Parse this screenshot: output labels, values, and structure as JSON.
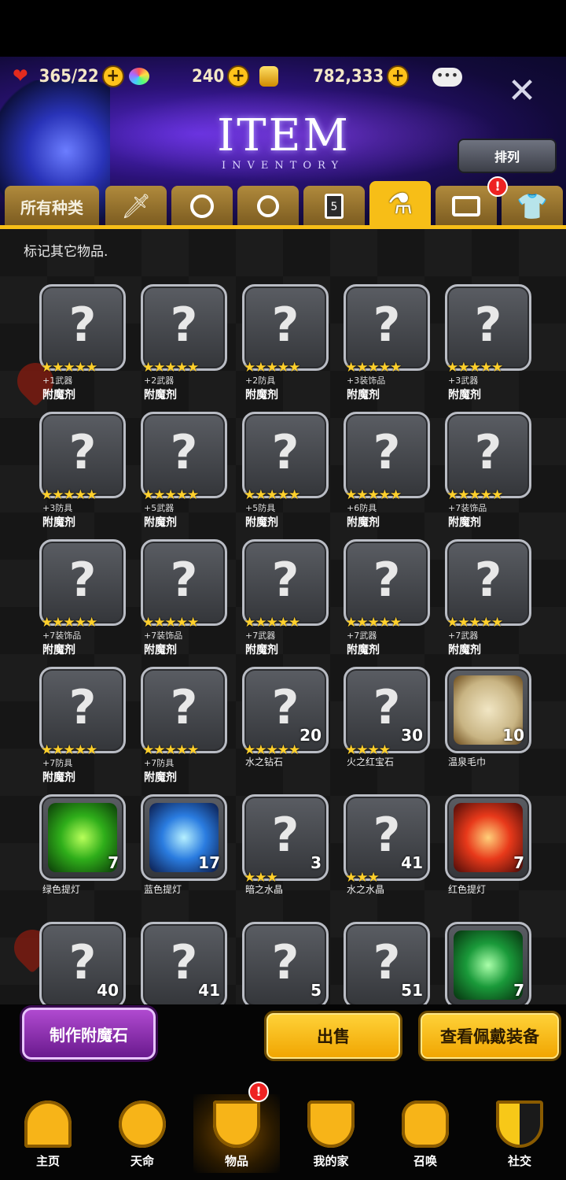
{
  "resources": {
    "hearts": "365/22",
    "gems": "240",
    "gold": "782,333"
  },
  "header": {
    "title": "ITEM",
    "subtitle": "INVENTORY",
    "sort_label": "排列"
  },
  "tabs": [
    {
      "label": "所有种类",
      "icon": "all"
    },
    {
      "label": "",
      "icon": "sword-icon"
    },
    {
      "label": "",
      "icon": "shield-icon"
    },
    {
      "label": "",
      "icon": "ring-icon"
    },
    {
      "label": "",
      "icon": "card-icon"
    },
    {
      "label": "",
      "icon": "potion-flask-icon"
    },
    {
      "label": "",
      "icon": "ticket-icon"
    },
    {
      "label": "",
      "icon": "costume-icon"
    }
  ],
  "hint": "标记其它物品.",
  "items": [
    {
      "stars": "★★★★★",
      "sub": "+1武器",
      "name": "附魔剂",
      "count": ""
    },
    {
      "stars": "★★★★★",
      "sub": "+2武器",
      "name": "附魔剂",
      "count": ""
    },
    {
      "stars": "★★★★★",
      "sub": "+2防具",
      "name": "附魔剂",
      "count": ""
    },
    {
      "stars": "★★★★★",
      "sub": "+3装饰品",
      "name": "附魔剂",
      "count": ""
    },
    {
      "stars": "★★★★★",
      "sub": "+3武器",
      "name": "附魔剂",
      "count": ""
    },
    {
      "stars": "★★★★★",
      "sub": "+3防具",
      "name": "附魔剂",
      "count": ""
    },
    {
      "stars": "★★★★★",
      "sub": "+5武器",
      "name": "附魔剂",
      "count": ""
    },
    {
      "stars": "★★★★★",
      "sub": "+5防具",
      "name": "附魔剂",
      "count": ""
    },
    {
      "stars": "★★★★★",
      "sub": "+6防具",
      "name": "附魔剂",
      "count": ""
    },
    {
      "stars": "★★★★★",
      "sub": "+7装饰品",
      "name": "附魔剂",
      "count": ""
    },
    {
      "stars": "★★★★★",
      "sub": "+7装饰品",
      "name": "附魔剂",
      "count": ""
    },
    {
      "stars": "★★★★★",
      "sub": "+7装饰品",
      "name": "附魔剂",
      "count": ""
    },
    {
      "stars": "★★★★★",
      "sub": "+7武器",
      "name": "附魔剂",
      "count": ""
    },
    {
      "stars": "★★★★★",
      "sub": "+7武器",
      "name": "附魔剂",
      "count": ""
    },
    {
      "stars": "★★★★★",
      "sub": "+7武器",
      "name": "附魔剂",
      "count": ""
    },
    {
      "stars": "★★★★★",
      "sub": "+7防具",
      "name": "附魔剂",
      "count": ""
    },
    {
      "stars": "★★★★★",
      "sub": "+7防具",
      "name": "附魔剂",
      "count": ""
    },
    {
      "stars": "★★★★★",
      "sub": "",
      "name": "水之钻石",
      "count": "20"
    },
    {
      "stars": "★★★★",
      "sub": "",
      "name": "火之红宝石",
      "count": "30"
    },
    {
      "stars": "",
      "sub": "",
      "name": "温泉毛巾",
      "count": "10",
      "art": "towel"
    },
    {
      "stars": "",
      "sub": "",
      "name": "绿色提灯",
      "count": "7",
      "art": "green-lantern"
    },
    {
      "stars": "",
      "sub": "",
      "name": "蓝色提灯",
      "count": "17",
      "art": "blue-lantern"
    },
    {
      "stars": "★★★",
      "sub": "",
      "name": "暗之水晶",
      "count": "3"
    },
    {
      "stars": "★★★",
      "sub": "",
      "name": "水之水晶",
      "count": "41"
    },
    {
      "stars": "",
      "sub": "",
      "name": "红色提灯",
      "count": "7",
      "art": "red-lantern"
    },
    {
      "stars": "",
      "sub": "",
      "name": "",
      "count": "40"
    },
    {
      "stars": "",
      "sub": "",
      "name": "",
      "count": "41"
    },
    {
      "stars": "",
      "sub": "",
      "name": "",
      "count": "5"
    },
    {
      "stars": "",
      "sub": "",
      "name": "",
      "count": "51"
    },
    {
      "stars": "",
      "sub": "",
      "name": "",
      "count": "7",
      "art": "green-box"
    }
  ],
  "buttons": {
    "craft": "制作附魔石",
    "sell": "出售",
    "view_equipped": "查看佩戴装备"
  },
  "nav": [
    {
      "label": "主页",
      "icon": "home-icon"
    },
    {
      "label": "天命",
      "icon": "destiny-flame-icon"
    },
    {
      "label": "物品",
      "icon": "items-sword-shield-icon"
    },
    {
      "label": "我的家",
      "icon": "crown-laurel-icon"
    },
    {
      "label": "召唤",
      "icon": "summon-bottle-icon"
    },
    {
      "label": "社交",
      "icon": "social-shield-icon"
    }
  ],
  "badges": {
    "tab_alert": "!",
    "nav_alert": "!"
  }
}
